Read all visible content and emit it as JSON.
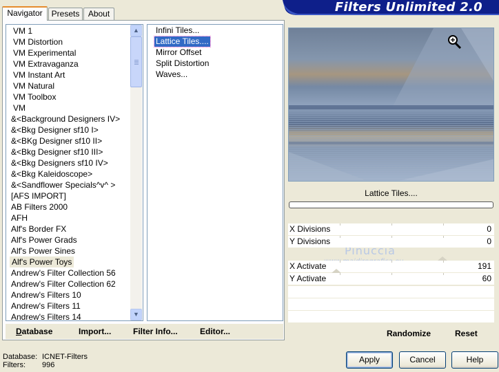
{
  "app": {
    "title": "Filters Unlimited 2.0"
  },
  "tabs": [
    {
      "label": "Navigator",
      "active": true
    },
    {
      "label": "Presets",
      "active": false
    },
    {
      "label": "About",
      "active": false
    }
  ],
  "categories": [
    "VM 1",
    "VM Distortion",
    "VM Experimental",
    "VM Extravaganza",
    "VM Instant Art",
    "VM Natural",
    "VM Toolbox",
    "VM",
    "&<Background Designers IV>",
    "&<Bkg Designer sf10 I>",
    "&<BKg Designer sf10 II>",
    "&<Bkg Designer sf10 III>",
    "&<Bkg Designers sf10 IV>",
    "&<Bkg Kaleidoscope>",
    "&<Sandflower Specials^v^ >",
    "[AFS IMPORT]",
    "AB Filters 2000",
    "AFH",
    "Alf's Border FX",
    "Alf's Power Grads",
    "Alf's Power Sines",
    "Alf's Power Toys",
    "Andrew's Filter Collection 56",
    "Andrew's Filter Collection 62",
    "Andrew's Filters 10",
    "Andrew's Filters 11",
    "Andrew's Filters 14"
  ],
  "selected_category": "Alf's Power Toys",
  "filters": [
    "Infini Tiles...",
    "Lattice Tiles....",
    "Mirror Offset",
    "Split Distortion",
    "Waves..."
  ],
  "selected_filter": "Lattice Tiles....",
  "left_toolbar": {
    "database": "Database",
    "import": "Import...",
    "filter_info": "Filter Info...",
    "editor": "Editor..."
  },
  "preview": {
    "filter_name": "Lattice Tiles...."
  },
  "params": [
    {
      "label": "X Divisions",
      "value": "0",
      "slider": 0
    },
    {
      "label": "Y Divisions",
      "value": "0",
      "slider": 0
    },
    {
      "label": "X Activate",
      "value": "191",
      "slider": 0.75
    },
    {
      "label": "Y Activate",
      "value": "60",
      "slider": 0.235
    }
  ],
  "watermark": {
    "name": "Pinuccia",
    "site": "www.maidiregrafica.eu"
  },
  "right_toolbar": {
    "randomize": "Randomize",
    "reset": "Reset"
  },
  "status": {
    "database_label": "Database:",
    "database_value": "ICNET-Filters",
    "filters_label": "Filters:",
    "filters_value": "996"
  },
  "buttons": {
    "apply": "Apply",
    "cancel": "Cancel",
    "help": "Help"
  }
}
